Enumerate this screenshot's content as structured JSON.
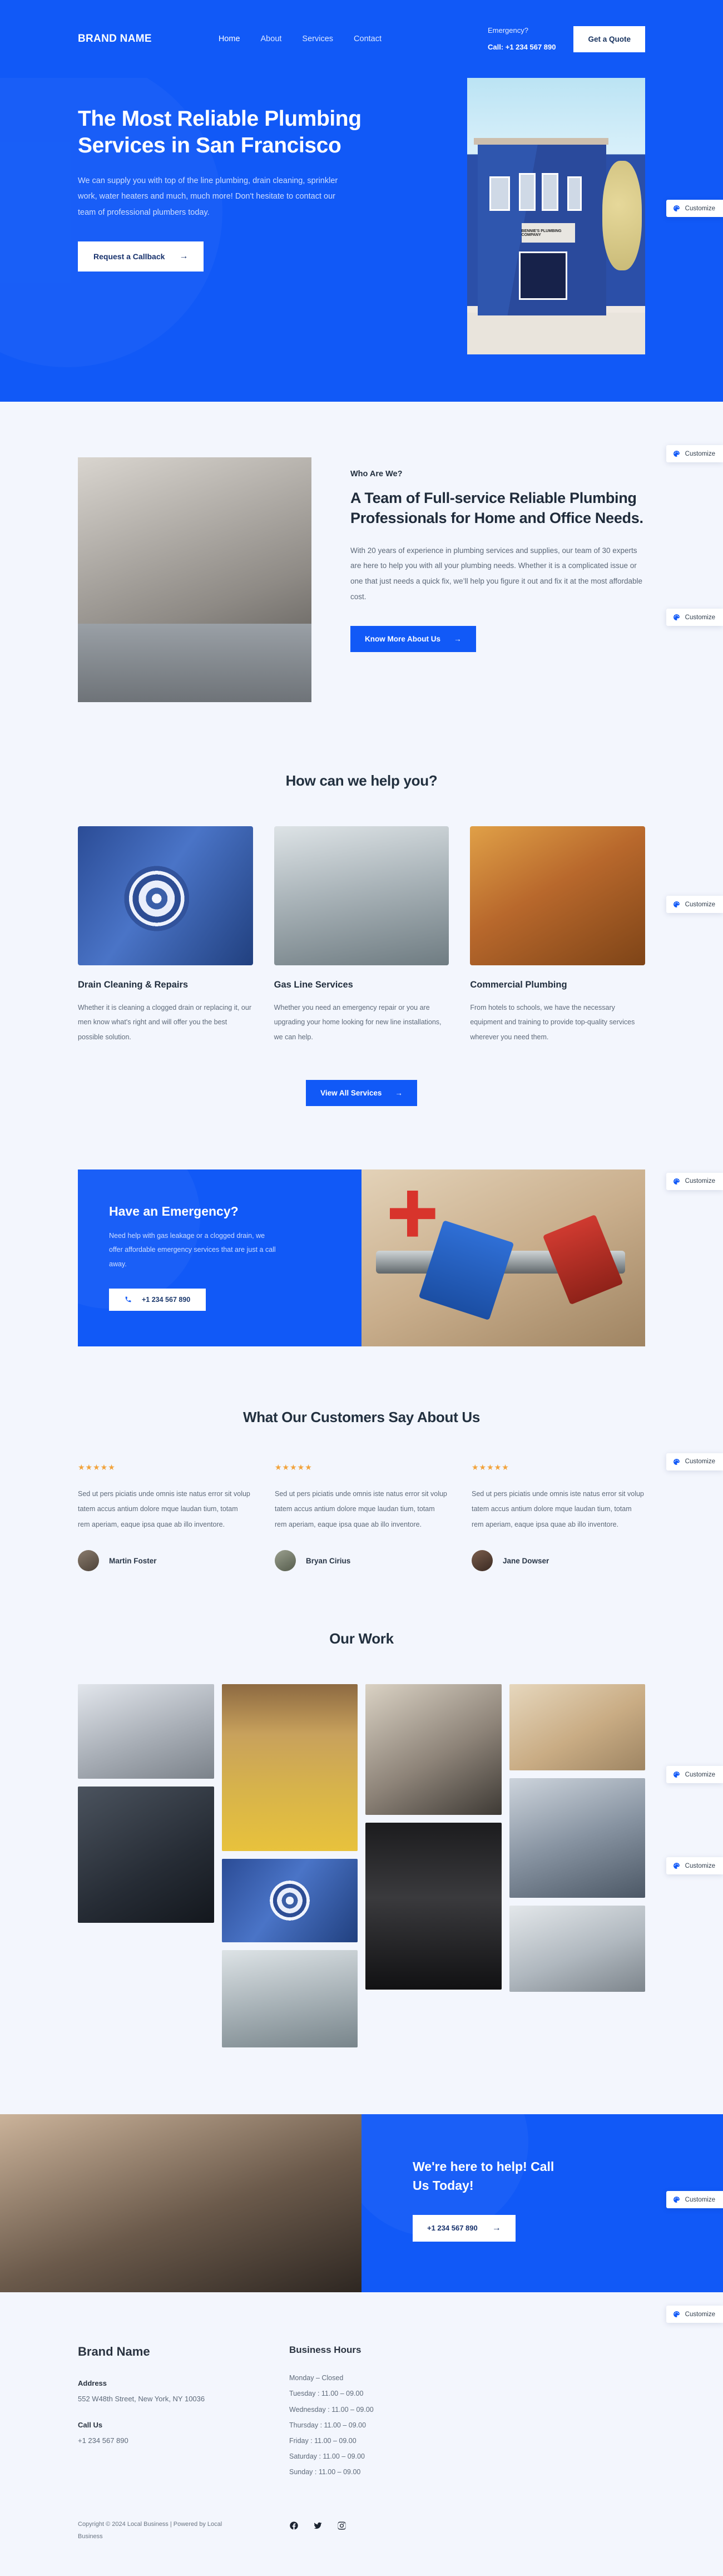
{
  "header": {
    "brand": "BRAND NAME",
    "nav": [
      {
        "label": "Home",
        "active": true
      },
      {
        "label": "About",
        "active": false
      },
      {
        "label": "Services",
        "active": false
      },
      {
        "label": "Contact",
        "active": false
      }
    ],
    "emergency_label": "Emergency?",
    "emergency_call": "Call: +1 234 567 890",
    "quote_button": "Get a Quote"
  },
  "hero": {
    "title": "The Most Reliable Plumbing Services in San Francisco",
    "body": "We can supply you with top of the line plumbing, drain cleaning, sprinkler work, water heaters and much, much more! Don't hesitate to contact our team of professional plumbers today.",
    "cta": "Request a Callback",
    "arrow": "→",
    "image_sign": "BENNIE'S PLUMBING COMPANY"
  },
  "about": {
    "eyebrow": "Who Are We?",
    "title": "A Team of Full-service Reliable Plumbing Professionals for Home and Office Needs.",
    "body": "With 20 years of experience in plumbing services and supplies, our team of 30 experts are here to help you with all your plumbing needs. Whether it is a complicated issue or one that just needs a quick fix, we’ll help you figure it out and fix it at the most affordable cost.",
    "cta": "Know More About Us",
    "arrow": "→"
  },
  "services": {
    "title": "How can we help you?",
    "items": [
      {
        "name": "Drain Cleaning & Repairs",
        "desc": "Whether it is cleaning a clogged drain or replacing it, our men know what's right and will offer you the best possible solution."
      },
      {
        "name": "Gas Line Services",
        "desc": "Whether you need an emergency repair or you are upgrading your home looking for new line installations, we can help."
      },
      {
        "name": "Commercial Plumbing",
        "desc": "From hotels to schools, we have the necessary equipment and training to provide top-quality services wherever you need them."
      }
    ],
    "view_all": "View All Services",
    "arrow": "→"
  },
  "emergency": {
    "title": "Have an Emergency?",
    "body": "Need help with gas leakage or a clogged drain, we offer affordable emergency services that are just a call away.",
    "phone": "+1 234 567 890"
  },
  "testimonials": {
    "title": "What Our Customers Say About Us",
    "items": [
      {
        "stars": "★★★★★",
        "text": "Sed ut pers piciatis unde omnis iste natus error sit volup tatem accus antium dolore mque laudan tium, totam rem aperiam, eaque ipsa quae ab illo inventore.",
        "name": "Martin Foster"
      },
      {
        "stars": "★★★★★",
        "text": "Sed ut pers piciatis unde omnis iste natus error sit volup tatem accus antium dolore mque laudan tium, totam rem aperiam, eaque ipsa quae ab illo inventore.",
        "name": "Bryan Cirius"
      },
      {
        "stars": "★★★★★",
        "text": "Sed ut pers piciatis unde omnis iste natus error sit volup tatem accus antium dolore mque laudan tium, totam rem aperiam, eaque ipsa quae ab illo inventore.",
        "name": "Jane Dowser"
      }
    ]
  },
  "gallery": {
    "title": "Our Work"
  },
  "cta": {
    "title": "We're here to help! Call Us Today!",
    "phone": "+1 234 567 890",
    "arrow": "→"
  },
  "footer": {
    "brand": "Brand Name",
    "address_label": "Address",
    "address_value": "552 W48th Street, New York, NY 10036",
    "call_label": "Call Us",
    "call_value": "+1 234 567 890",
    "hours_title": "Business Hours",
    "hours": [
      "Monday – Closed",
      "Tuesday : 11.00 – 09.00",
      "Wednesday : 11.00 – 09.00",
      "Thursday : 11.00 – 09.00",
      "Friday : 11.00 – 09.00",
      "Saturday : 11.00 – 09.00",
      "Sunday : 11.00 – 09.00"
    ],
    "copyright": "Copyright © 2024 Local Business | Powered by Local Business"
  },
  "customize": {
    "label": "Customize"
  },
  "colors": {
    "brand_blue": "#1159f7",
    "page_bg": "#f3f6fd",
    "star_gold": "#f2a33c",
    "heading": "#22303f"
  }
}
